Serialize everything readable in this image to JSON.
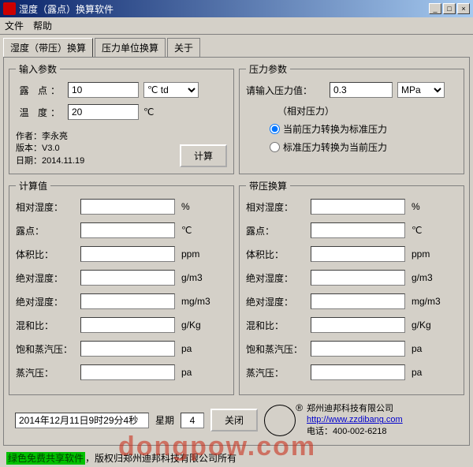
{
  "title": "湿度（露点）换算软件",
  "menu": {
    "file": "文件",
    "help": "帮助"
  },
  "tabs": {
    "t1": "湿度（带压）换算",
    "t2": "压力单位换算",
    "t3": "关于"
  },
  "input": {
    "legend": "输入参数",
    "dew_label": "露 点：",
    "dew_value": "10",
    "dew_unit": "℃ td",
    "temp_label": "温 度：",
    "temp_value": "20",
    "temp_unit": "℃",
    "author_line": "作者：李永亮",
    "version_line": "版本：V3.0",
    "date_line": "日期：2014.11.19",
    "calc": "计算"
  },
  "pressure": {
    "legend": "压力参数",
    "prompt": "请输入压力值：",
    "value": "0.3",
    "unit": "MPa",
    "hint": "（相对压力）",
    "r1": "当前压力转换为标准压力",
    "r2": "标准压力转换为当前压力"
  },
  "calc": {
    "legend": "计算值",
    "rh": "相对湿度：",
    "rh_u": "%",
    "dew": "露点：",
    "dew_u": "℃",
    "vol": "体积比：",
    "vol_u": "ppm",
    "abs1": "绝对湿度：",
    "abs1_u": "g/m3",
    "abs2": "绝对湿度：",
    "abs2_u": "mg/m3",
    "mix": "混和比：",
    "mix_u": "g/Kg",
    "sat": "饱和蒸汽压：",
    "sat_u": "pa",
    "vap": "蒸汽压：",
    "vap_u": "pa"
  },
  "press_calc": {
    "legend": "带压换算",
    "rh": "相对湿度：",
    "rh_u": "%",
    "dew": "露点：",
    "dew_u": "℃",
    "vol": "体积比：",
    "vol_u": "ppm",
    "abs1": "绝对湿度：",
    "abs1_u": "g/m3",
    "abs2": "绝对湿度：",
    "abs2_u": "mg/m3",
    "mix": "混和比：",
    "mix_u": "g/Kg",
    "sat": "饱和蒸汽压：",
    "sat_u": "pa",
    "vap": "蒸汽压：",
    "vap_u": "pa"
  },
  "bottom": {
    "datetime": "2014年12月11日9时29分4秒",
    "week_label": "星期",
    "week_value": "4",
    "close": "关闭"
  },
  "footer": {
    "highlight": "绿色免费共享软件",
    "rest": "，版权归郑州迪邦科技有限公司所有"
  },
  "company": {
    "name": "郑州迪邦科技有限公司",
    "url": "http://www.zzdibang.com",
    "tel": "电话：400-002-6218"
  },
  "watermark": "dongpow.com"
}
